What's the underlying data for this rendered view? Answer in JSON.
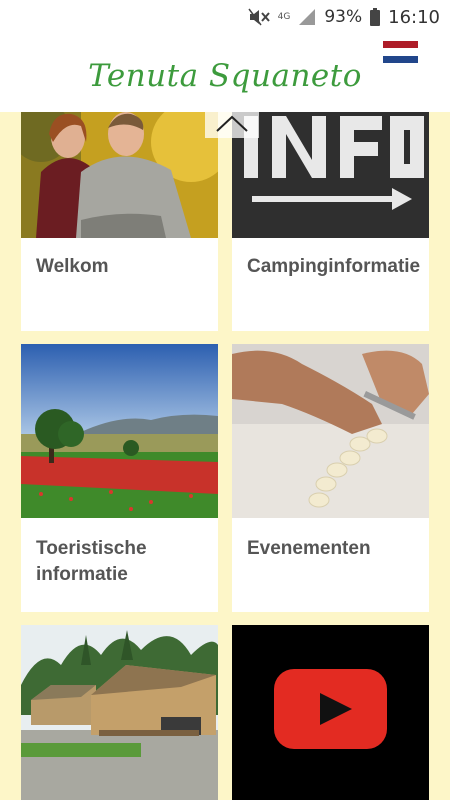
{
  "status_bar": {
    "mute_icon": "mute-icon",
    "network": "4G",
    "battery_percent": "93%",
    "time": "16:10"
  },
  "header": {
    "logo_text": "Tenuta Squaneto",
    "language_flag": "netherlands-flag",
    "flag_colors": [
      "#ae1c28",
      "#ffffff",
      "#21468b"
    ]
  },
  "tiles": [
    {
      "label": "Welkom"
    },
    {
      "label": "Campinginformatie"
    },
    {
      "label": "Toeristische informatie"
    },
    {
      "label": "Evenementen"
    },
    {
      "label": ""
    },
    {
      "label": ""
    }
  ],
  "colors": {
    "background": "#fdf6c8",
    "logo_green": "#3d9b3d",
    "tile_text": "#555555",
    "youtube_red": "#e32b22"
  }
}
